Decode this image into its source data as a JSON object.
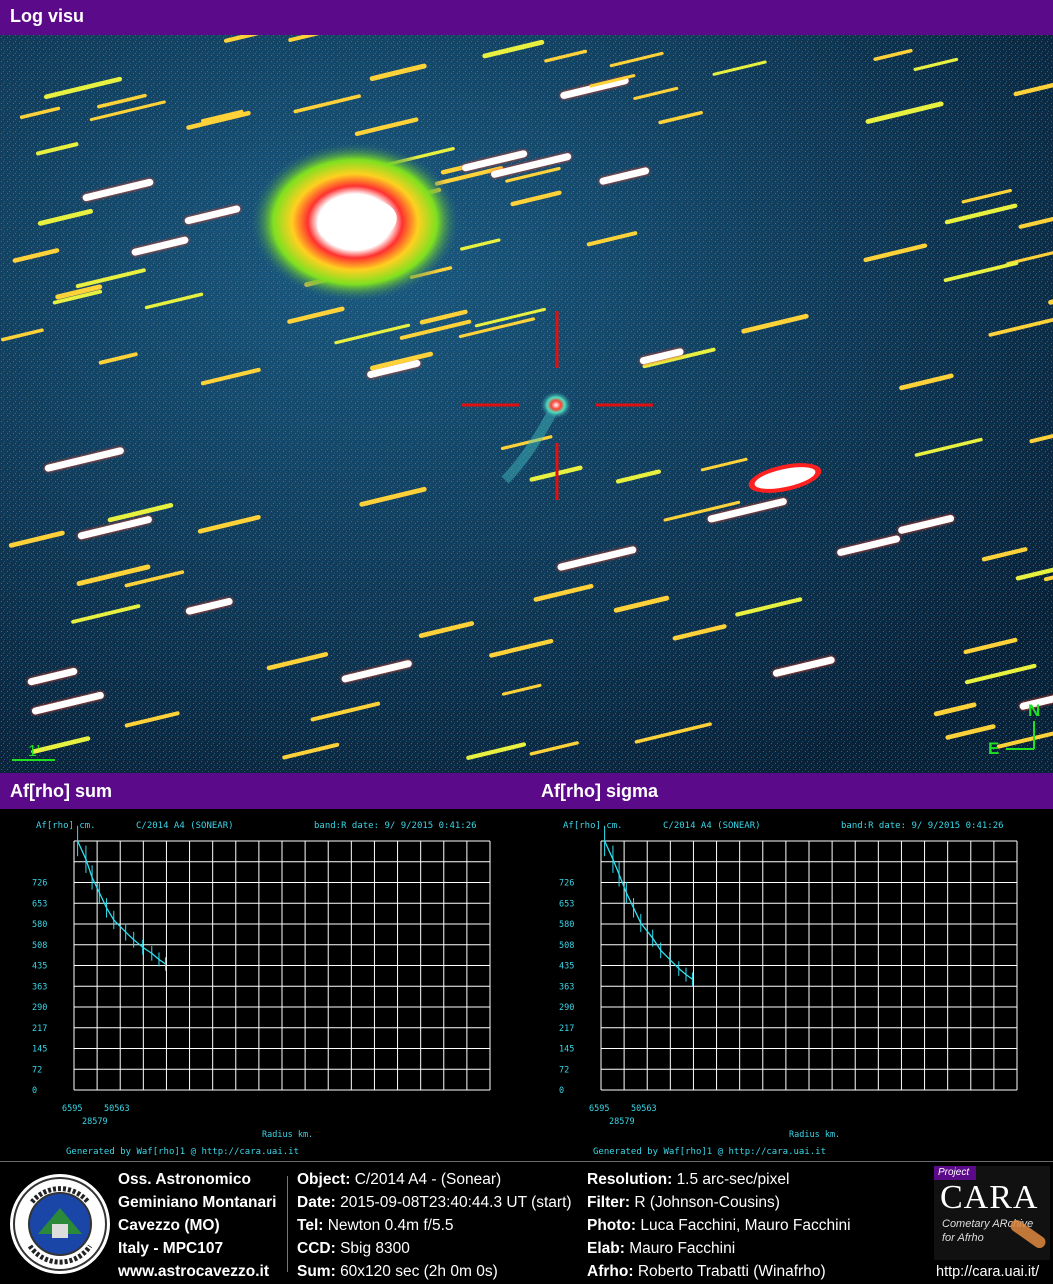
{
  "sections": {
    "image_title": "Log visu",
    "sum_title": "Af[rho] sum",
    "sigma_title": "Af[rho] sigma"
  },
  "image": {
    "scale_label": "1'",
    "north": "N",
    "east": "E"
  },
  "colors": {
    "header_bg": "#5b0a8a",
    "crosshair": "#e01010",
    "plot_text": "#3ad6e8",
    "grid": "#ffffff",
    "curve": "#30e0f0"
  },
  "chart_data": [
    {
      "type": "line",
      "panel": "Af[rho] sum",
      "ylabel": "Af[rho] cm.",
      "object": "C/2014 A4 (SONEAR)",
      "band_date": "band:R date:  9/ 9/2015  0:41:26",
      "yticks": [
        "0",
        "72",
        "145",
        "217",
        "290",
        "363",
        "435",
        "508",
        "580",
        "653",
        "726"
      ],
      "xticks": [
        "6595",
        "28579",
        "50563"
      ],
      "xlabel": "Radius km.",
      "footer": "Generated by Waf[rho]1 @ http://cara.uai.it",
      "ylim": [
        0,
        820
      ],
      "xlim": [
        0,
        230000
      ],
      "series": [
        {
          "x": [
            2000,
            6595,
            10000,
            14000,
            18000,
            22000,
            28579,
            33000,
            38000,
            43000,
            47000,
            50563
          ],
          "values": [
            820,
            760,
            700,
            650,
            600,
            560,
            520,
            495,
            470,
            450,
            430,
            415
          ],
          "err": [
            50,
            45,
            40,
            35,
            32,
            30,
            28,
            26,
            25,
            24,
            23,
            22
          ]
        }
      ]
    },
    {
      "type": "line",
      "panel": "Af[rho] sigma",
      "ylabel": "Af[rho] cm.",
      "object": "C/2014 A4 (SONEAR)",
      "band_date": "band:R date:  9/ 9/2015  0:41:26",
      "yticks": [
        "0",
        "72",
        "145",
        "217",
        "290",
        "363",
        "435",
        "508",
        "580",
        "653",
        "726"
      ],
      "xticks": [
        "6595",
        "28579",
        "50563"
      ],
      "xlabel": "Radius km.",
      "footer": "Generated by Waf[rho]1 @ http://cara.uai.it",
      "ylim": [
        0,
        820
      ],
      "xlim": [
        0,
        230000
      ],
      "series": [
        {
          "x": [
            2000,
            6595,
            10000,
            14000,
            18000,
            22000,
            28579,
            33000,
            38000,
            43000,
            47000,
            50563
          ],
          "values": [
            820,
            760,
            710,
            650,
            600,
            550,
            500,
            460,
            430,
            400,
            380,
            365
          ],
          "err": [
            50,
            45,
            40,
            35,
            32,
            30,
            28,
            26,
            25,
            24,
            23,
            22
          ]
        }
      ]
    }
  ],
  "footer": {
    "observatory": [
      "Oss. Astronomico",
      "Geminiano Montanari",
      "Cavezzo (MO)",
      "Italy - MPC107",
      "www.astrocavezzo.it"
    ],
    "col1": [
      {
        "label": "Object:",
        "value": "C/2014 A4 - (Sonear)"
      },
      {
        "label": "Date:",
        "value": "2015-09-08T23:40:44.3 UT (start)"
      },
      {
        "label": "Tel:",
        "value": "Newton 0.4m f/5.5"
      },
      {
        "label": "CCD:",
        "value": "Sbig 8300"
      },
      {
        "label": "Sum:",
        "value": "60x120 sec (2h 0m 0s)"
      }
    ],
    "col2": [
      {
        "label": "Resolution:",
        "value": "1.5 arc-sec/pixel"
      },
      {
        "label": "Filter:",
        "value": "R (Johnson-Cousins)"
      },
      {
        "label": "Photo:",
        "value": "Luca Facchini, Mauro Facchini"
      },
      {
        "label": "Elab:",
        "value": "Mauro Facchini"
      },
      {
        "label": "Afrho:",
        "value": "Roberto Trabatti (Winafrho)"
      }
    ],
    "logo_seal_text": "OSSERVATORIO ASTRONOMICO G. MONTANARI CAVEZZO MO",
    "cara": {
      "project": "Project",
      "name": "CARA",
      "line1": "Cometary ARchive",
      "line2": "for Afrho",
      "url": "http://cara.uai.it/"
    }
  }
}
